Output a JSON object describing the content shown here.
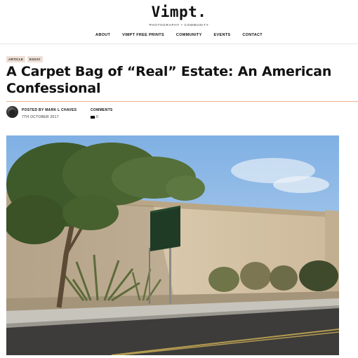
{
  "header": {
    "logo": "Vimpt.",
    "tagline": "PHOTOGRAPHY • COMMUNITY",
    "nav": [
      "ABOUT",
      "VIMPT FREE PRINTS",
      "COMMUNITY",
      "EVENTS",
      "CONTACT"
    ]
  },
  "article": {
    "tags": [
      "ARTICLE",
      "ESSAY"
    ],
    "title": "A Carpet Bag of “Real” Estate: An American Confessional",
    "posted_by_label": "POSTED BY MARK L CHAVES",
    "date": "7TH OCTOBER 2017",
    "comments_label": "COMMENTS",
    "comments_count": "0"
  },
  "colors": {
    "accent_rule": "#e9b38e",
    "tag_bg": "#eedfd5"
  }
}
